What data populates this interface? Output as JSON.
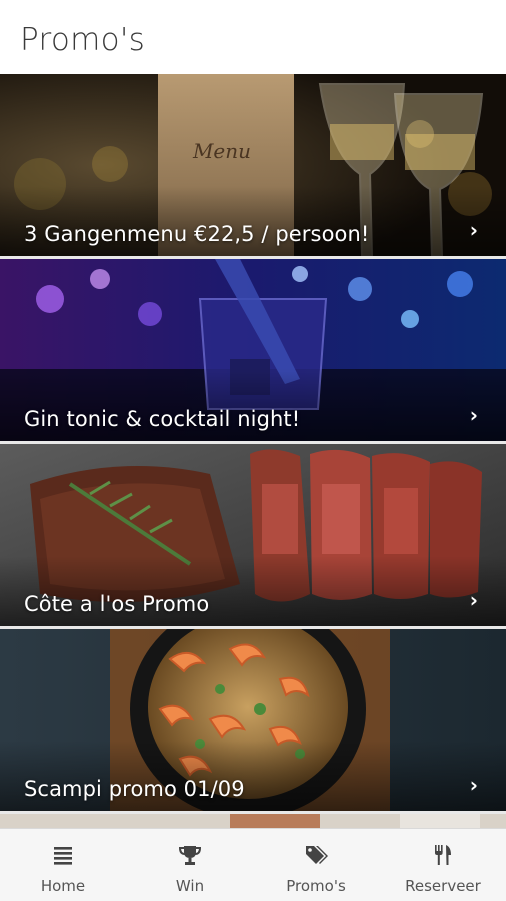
{
  "header": {
    "title": "Promo's"
  },
  "promos": [
    {
      "label": "3 Gangenmenu €22,5 / persoon!",
      "image": "menu-card-and-wine-glasses",
      "menu_card_text": "Menu"
    },
    {
      "label": "Gin tonic & cocktail night!",
      "image": "blue-cocktail-glass-with-bokeh"
    },
    {
      "label": "Côte a l'os Promo",
      "image": "sliced-grilled-steak-with-rosemary"
    },
    {
      "label": "Scampi promo 01/09",
      "image": "shrimp-noodle-dish-in-bowl"
    }
  ],
  "chevron": "›",
  "tabbar": {
    "tabs": [
      {
        "label": "Home",
        "icon": "list-icon"
      },
      {
        "label": "Win",
        "icon": "trophy-icon"
      },
      {
        "label": "Promo's",
        "icon": "tags-icon"
      },
      {
        "label": "Reserveer",
        "icon": "cutlery-icon"
      }
    ]
  }
}
